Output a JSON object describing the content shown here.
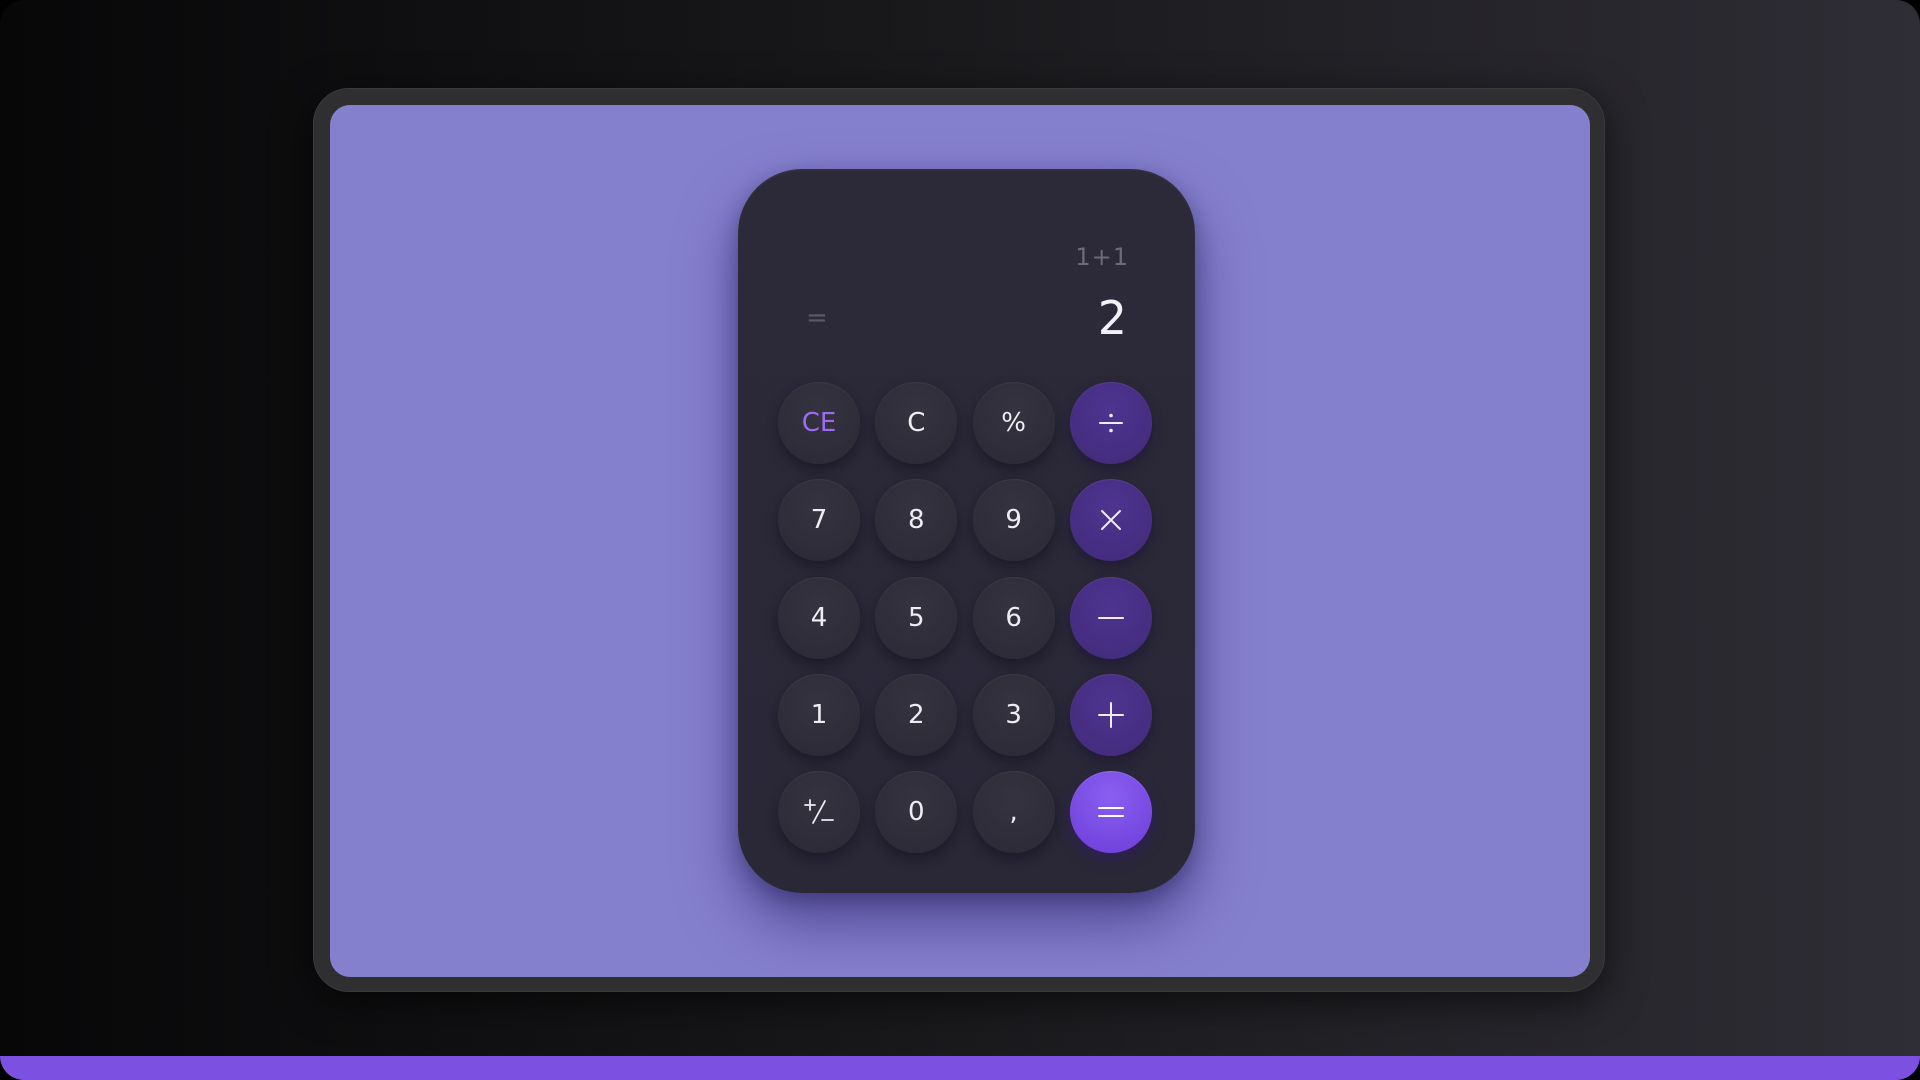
{
  "colors": {
    "accent": "#7c50e0",
    "screen_background": "#8580ce",
    "calculator_body": "#2c2a39",
    "operator_key": "#452d80",
    "equals_key": "#7547e0",
    "clear_entry_text": "#9b6cf0"
  },
  "display": {
    "expression": "1+1",
    "equals_indicator": "=",
    "result": "2"
  },
  "keys": [
    {
      "label": "CE",
      "type": "function",
      "icon": null
    },
    {
      "label": "C",
      "type": "function",
      "icon": null
    },
    {
      "label": "%",
      "type": "function",
      "icon": null
    },
    {
      "label": "÷",
      "type": "operator",
      "icon": "divide-icon"
    },
    {
      "label": "7",
      "type": "digit",
      "icon": null
    },
    {
      "label": "8",
      "type": "digit",
      "icon": null
    },
    {
      "label": "9",
      "type": "digit",
      "icon": null
    },
    {
      "label": "×",
      "type": "operator",
      "icon": "multiply-icon"
    },
    {
      "label": "4",
      "type": "digit",
      "icon": null
    },
    {
      "label": "5",
      "type": "digit",
      "icon": null
    },
    {
      "label": "6",
      "type": "digit",
      "icon": null
    },
    {
      "label": "−",
      "type": "operator",
      "icon": "minus-icon"
    },
    {
      "label": "1",
      "type": "digit",
      "icon": null
    },
    {
      "label": "2",
      "type": "digit",
      "icon": null
    },
    {
      "label": "3",
      "type": "digit",
      "icon": null
    },
    {
      "label": "+",
      "type": "operator",
      "icon": "plus-icon"
    },
    {
      "label": "+/-",
      "type": "function",
      "icon": "plus-minus-icon"
    },
    {
      "label": "0",
      "type": "digit",
      "icon": null
    },
    {
      "label": ",",
      "type": "digit",
      "icon": null
    },
    {
      "label": "=",
      "type": "equals",
      "icon": "equals-icon"
    }
  ]
}
